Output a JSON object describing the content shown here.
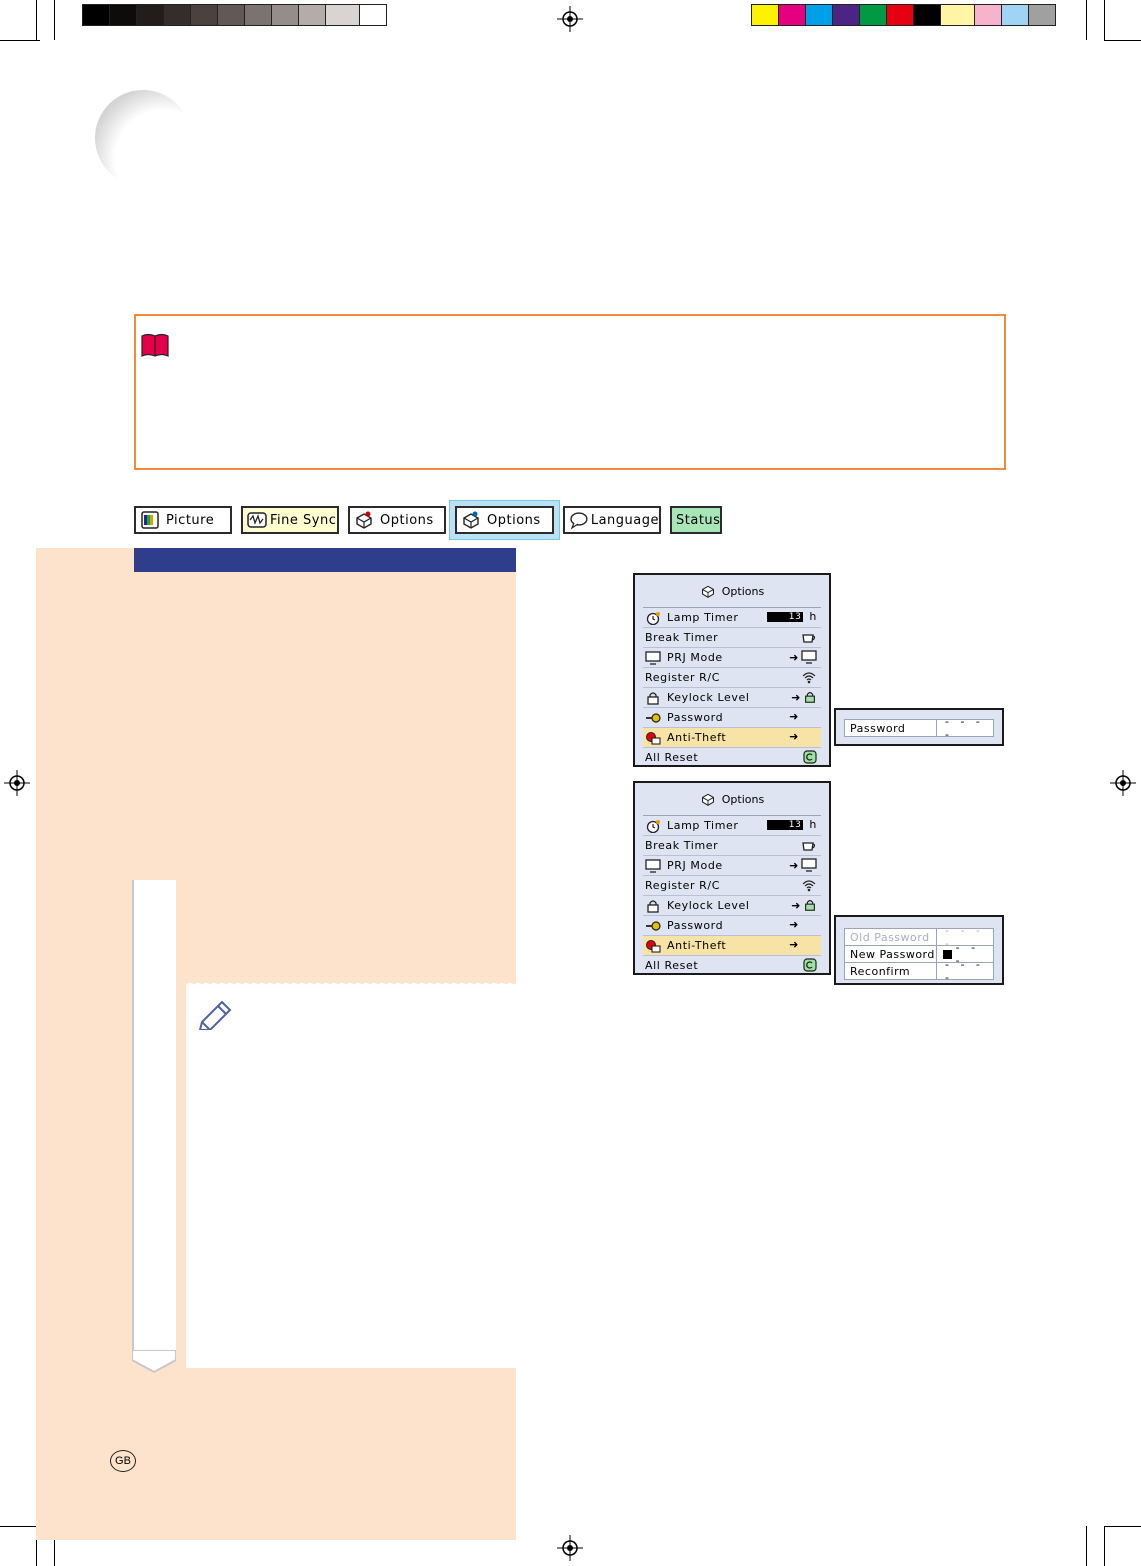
{
  "tabs": [
    {
      "label": "Picture"
    },
    {
      "label": "Fine Sync"
    },
    {
      "label": "Options"
    },
    {
      "label": "Options"
    },
    {
      "label": "Language"
    },
    {
      "label": "Status"
    }
  ],
  "menu": {
    "title": "Options",
    "lamp_value": "13",
    "lamp_unit": "h",
    "items": [
      {
        "label": "Lamp Timer"
      },
      {
        "label": "Break Timer"
      },
      {
        "label": "PRJ Mode"
      },
      {
        "label": "Register R/C"
      },
      {
        "label": "Keylock Level"
      },
      {
        "label": "Password"
      },
      {
        "label": "Anti-Theft"
      },
      {
        "label": "All Reset"
      }
    ]
  },
  "password_popup": {
    "label": "Password",
    "value": "- - - -"
  },
  "change_popup": {
    "old_label": "Old Password",
    "old_value": "- - - -",
    "new_label": "New Password",
    "new_value": "- - -",
    "reconfirm_label": "Reconfirm",
    "reconfirm_value": "- - - -"
  },
  "region_badge": "GB",
  "colors": {
    "tab_yellow": "#ffffd2",
    "tab_blue": "#cfe9f7",
    "tab_green": "#a8e6b8",
    "note_border": "#f08a3c",
    "peach": "#fde3cc",
    "header_blue": "#2f3e8c"
  }
}
